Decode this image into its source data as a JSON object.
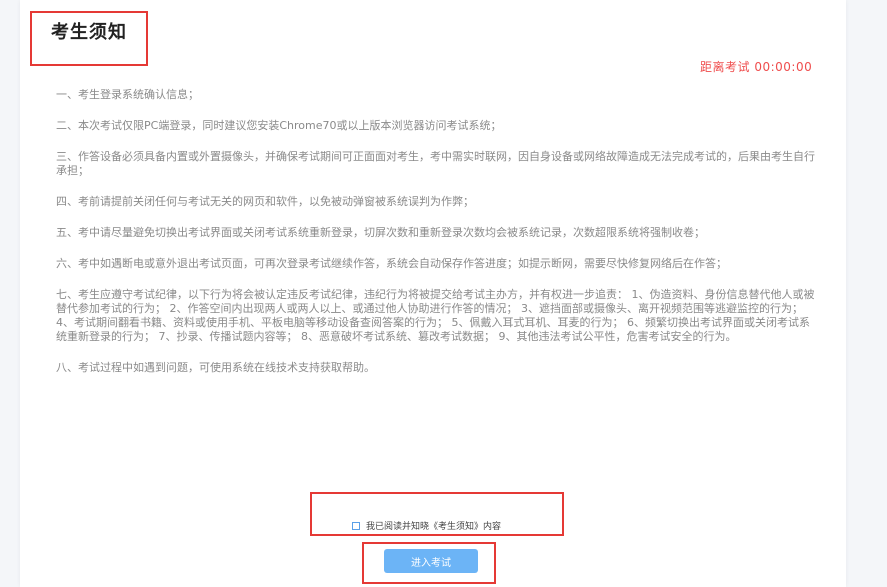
{
  "header": {
    "title": "考生须知",
    "countdown": "距离考试 00:00:00"
  },
  "notices": [
    "一、考生登录系统确认信息；",
    "二、本次考试仅限PC端登录，同时建议您安装Chrome70或以上版本浏览器访问考试系统；",
    "三、作答设备必须具备内置或外置摄像头，并确保考试期间可正面面对考生，考中需实时联网，因自身设备或网络故障造成无法完成考试的，后果由考生自行承担；",
    "四、考前请提前关闭任何与考试无关的网页和软件，以免被动弹窗被系统误判为作弊；",
    "五、考中请尽量避免切换出考试界面或关闭考试系统重新登录，切屏次数和重新登录次数均会被系统记录，次数超限系统将强制收卷；",
    "六、考中如遇断电或意外退出考试页面，可再次登录考试继续作答，系统会自动保存作答进度；如提示断网，需要尽快修复网络后在作答；",
    "七、考生应遵守考试纪律，以下行为将会被认定违反考试纪律，违纪行为将被提交给考试主办方，并有权进一步追责： 1、伪造资料、身份信息替代他人或被替代参加考试的行为； 2、作答空间内出现两人或两人以上、或通过他人协助进行作答的情况； 3、遮挡面部或摄像头、离开视频范围等逃避监控的行为； 4、考试期间翻看书籍、资料或使用手机、平板电脑等移动设备查阅答案的行为； 5、佩戴入耳式耳机、耳麦的行为； 6、频繁切换出考试界面或关闭考试系统重新登录的行为； 7、抄录、传播试题内容等； 8、恶意破坏考试系统、篡改考试数据； 9、其他违法考试公平性，危害考试安全的行为。",
    "八、考试过程中如遇到问题，可使用系统在线技术支持获取帮助。"
  ],
  "consent": {
    "label": "我已阅读并知晓《考生须知》内容",
    "checked": false
  },
  "actions": {
    "enter_label": "进入考试"
  },
  "colors": {
    "countdown": "#ef4d4d",
    "button": "#6cb4f6",
    "highlight": "#e53935"
  }
}
